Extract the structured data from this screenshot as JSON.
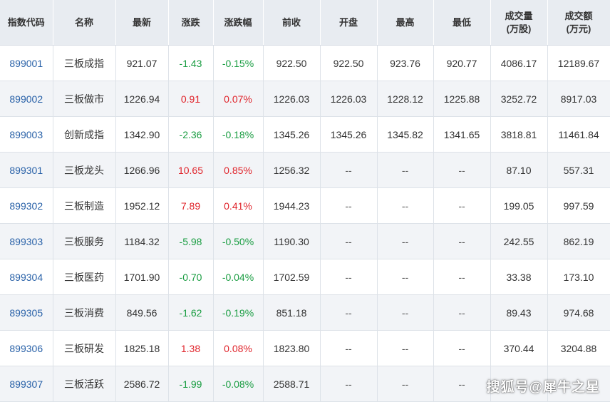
{
  "colors": {
    "header_bg": "#e8ecf1",
    "alt_row_bg": "#f2f4f7",
    "code_link": "#2a62a8",
    "up": "#e0242b",
    "down": "#1a9d42"
  },
  "table": {
    "headers": [
      [
        "指数代码"
      ],
      [
        "名称"
      ],
      [
        "最新"
      ],
      [
        "涨跌"
      ],
      [
        "涨跌幅"
      ],
      [
        "前收"
      ],
      [
        "开盘"
      ],
      [
        "最高"
      ],
      [
        "最低"
      ],
      [
        "成交量",
        "(万股)"
      ],
      [
        "成交额",
        "(万元)"
      ]
    ],
    "rows": [
      [
        "899001",
        "三板成指",
        "921.07",
        "-1.43",
        "-0.15%",
        "922.50",
        "922.50",
        "923.76",
        "920.77",
        "4086.17",
        "12189.67"
      ],
      [
        "899002",
        "三板做市",
        "1226.94",
        "0.91",
        "0.07%",
        "1226.03",
        "1226.03",
        "1228.12",
        "1225.88",
        "3252.72",
        "8917.03"
      ],
      [
        "899003",
        "创新成指",
        "1342.90",
        "-2.36",
        "-0.18%",
        "1345.26",
        "1345.26",
        "1345.82",
        "1341.65",
        "3818.81",
        "11461.84"
      ],
      [
        "899301",
        "三板龙头",
        "1266.96",
        "10.65",
        "0.85%",
        "1256.32",
        "--",
        "--",
        "--",
        "87.10",
        "557.31"
      ],
      [
        "899302",
        "三板制造",
        "1952.12",
        "7.89",
        "0.41%",
        "1944.23",
        "--",
        "--",
        "--",
        "199.05",
        "997.59"
      ],
      [
        "899303",
        "三板服务",
        "1184.32",
        "-5.98",
        "-0.50%",
        "1190.30",
        "--",
        "--",
        "--",
        "242.55",
        "862.19"
      ],
      [
        "899304",
        "三板医药",
        "1701.90",
        "-0.70",
        "-0.04%",
        "1702.59",
        "--",
        "--",
        "--",
        "33.38",
        "173.10"
      ],
      [
        "899305",
        "三板消费",
        "849.56",
        "-1.62",
        "-0.19%",
        "851.18",
        "--",
        "--",
        "--",
        "89.43",
        "974.68"
      ],
      [
        "899306",
        "三板研发",
        "1825.18",
        "1.38",
        "0.08%",
        "1823.80",
        "--",
        "--",
        "--",
        "370.44",
        "3204.88"
      ],
      [
        "899307",
        "三板活跃",
        "2586.72",
        "-1.99",
        "-0.08%",
        "2588.71",
        "--",
        "--",
        "--",
        "",
        ""
      ]
    ]
  },
  "watermark": "搜狐号@犀牛之星"
}
